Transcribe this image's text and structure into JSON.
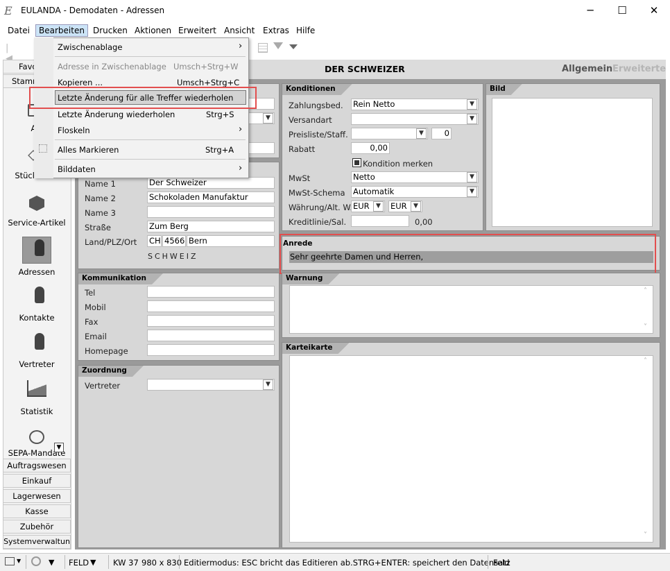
{
  "window": {
    "app_icon": "E",
    "title": "EULANDA - Demodaten - Adressen",
    "minimize": "─",
    "maximize": "☐",
    "close": "✕"
  },
  "menubar": [
    "Datei",
    "Bearbeiten",
    "Drucken",
    "Aktionen",
    "Erweitert",
    "Ansicht",
    "Extras",
    "Hilfe"
  ],
  "sidebar": {
    "tab_top1": "Favo",
    "tab_top2": "Stamm",
    "items": [
      "Art",
      "Stücklisten",
      "Service-Artikel",
      "Adressen",
      "Kontakte",
      "Vertreter",
      "Statistik",
      "SEPA-Mandate"
    ],
    "bottom_tabs": [
      "Auftragswesen",
      "Einkauf",
      "Lagerwesen",
      "Kasse",
      "Zubehör",
      "Systemverwaltun"
    ]
  },
  "header": {
    "title": "DER SCHWEIZER",
    "tab_general": "Allgemein",
    "tab_extended": "Erweiterte"
  },
  "address": {
    "labels": [
      "Name 1",
      "Name 2",
      "Name 3",
      "Straße",
      "Land/PLZ/Ort"
    ],
    "name1": "Der Schweizer",
    "name2": "Schokoladen Manufaktur",
    "name3": "",
    "street": "Zum Berg",
    "country": "CH",
    "zip": "4566",
    "city": "Bern",
    "country_name": "SCHWEIZ"
  },
  "communication": {
    "title": "Kommunikation",
    "labels": [
      "Tel",
      "Mobil",
      "Fax",
      "Email",
      "Homepage"
    ]
  },
  "assignment": {
    "title": "Zuordnung",
    "label": "Vertreter",
    "value": ""
  },
  "conditions": {
    "title": "Konditionen",
    "labels": [
      "Zahlungsbed.",
      "Versandart",
      "Preisliste/Staff.",
      "Rabatt",
      "MwSt",
      "MwSt-Schema",
      "Währung/Alt. W.",
      "Kreditlinie/Sal."
    ],
    "payment": "Rein Netto",
    "shipping": "",
    "pricelist": "",
    "pricelist_num": "0",
    "discount": "0,00",
    "remember": "Kondition merken",
    "vat": "Netto",
    "vat_scheme": "Automatik",
    "currency": "EUR",
    "alt_currency": "EUR",
    "credit": "",
    "saldo": "0,00"
  },
  "image": {
    "title": "Bild"
  },
  "salutation": {
    "title": "Anrede",
    "value": "Sehr geehrte Damen und Herren,"
  },
  "warning": {
    "title": "Warnung"
  },
  "card": {
    "title": "Karteikarte"
  },
  "dropdown_menu": {
    "items": [
      {
        "label": "Zwischenablage",
        "shortcut": "",
        "arrow": "›"
      },
      {
        "label": "Adresse in Zwischenablage",
        "shortcut": "Umsch+Strg+W"
      },
      {
        "label": "Kopieren ...",
        "shortcut": "Umsch+Strg+C"
      },
      {
        "label": "Letzte Änderung für alle Treffer wiederholen",
        "shortcut": ""
      },
      {
        "label": "Letzte Änderung wiederholen",
        "shortcut": "Strg+S"
      },
      {
        "label": "Floskeln",
        "shortcut": "",
        "arrow": "›"
      },
      {
        "label": "Alles Markieren",
        "shortcut": "Strg+A"
      },
      {
        "label": "Bilddaten",
        "shortcut": "",
        "arrow": "›"
      }
    ]
  },
  "statusbar": {
    "mode": "FELD",
    "kw": "KW 37",
    "resolution": "980 x 830",
    "message": "Editiermodus: ESC bricht das Editieren ab.STRG+ENTER: speichert den Datensatz",
    "field": "Feld"
  }
}
